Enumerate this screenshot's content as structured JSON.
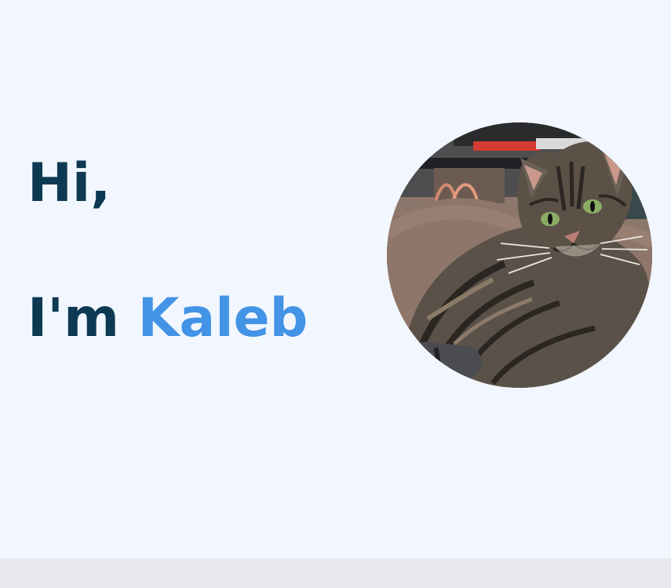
{
  "hero": {
    "greeting": "Hi,",
    "intro_prefix": "I'm ",
    "name": "Kaleb"
  },
  "avatar": {
    "description_icon": "cat-photo"
  },
  "colors": {
    "background": "#f2f7ff",
    "heading": "#0d3a52",
    "accent": "#4393e6",
    "footer": "#e7e9ec"
  }
}
